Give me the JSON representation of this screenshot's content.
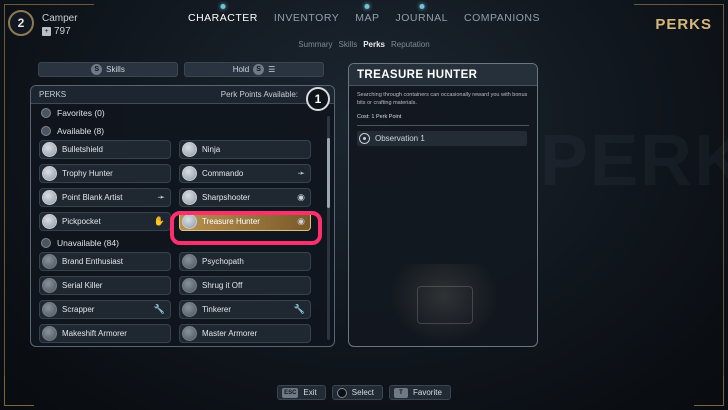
{
  "player": {
    "level": "2",
    "name": "Camper",
    "xp": "797"
  },
  "nav": {
    "tabs": [
      "CHARACTER",
      "INVENTORY",
      "MAP",
      "JOURNAL",
      "COMPANIONS"
    ],
    "active_tab": "CHARACTER",
    "subtabs": [
      "Summary",
      "Skills",
      "Perks",
      "Reputation"
    ],
    "active_subtab": "Perks"
  },
  "screen_title": "PERKS",
  "toolbar": {
    "skills_key": "S",
    "skills_label": "Skills",
    "hold_label": "Hold",
    "hold_key": "S"
  },
  "perks_panel": {
    "header": "PERKS",
    "points_label": "Perk Points Available:",
    "points": "1",
    "favorites": "Favorites (0)",
    "available": "Available (8)",
    "unavailable": "Unavailable (84)",
    "available_perks": [
      {
        "left": "Bulletshield",
        "right": "Ninja"
      },
      {
        "left": "Trophy Hunter",
        "right": "Commando"
      },
      {
        "left": "Point Blank Artist",
        "right": "Sharpshooter"
      },
      {
        "left": "Pickpocket",
        "right": "Treasure Hunter"
      }
    ],
    "unavailable_perks": [
      {
        "left": "Brand Enthusiast",
        "right": "Psychopath"
      },
      {
        "left": "Serial Killer",
        "right": "Shrug it Off"
      },
      {
        "left": "Scrapper",
        "right": "Tinkerer"
      },
      {
        "left": "Makeshift Armorer",
        "right": "Master Armorer"
      }
    ],
    "selected": "Treasure Hunter"
  },
  "detail": {
    "title": "TREASURE HUNTER",
    "description": "Searching through containers can occasionally reward you with bonus bits or crafting materials.",
    "cost": "Cost: 1 Perk Point",
    "requirement": "Observation 1",
    "background_word": "PERKS"
  },
  "footer": [
    {
      "key": "ESC",
      "label": "Exit"
    },
    {
      "key": "",
      "label": "Select"
    },
    {
      "key": "T",
      "label": "Favorite"
    }
  ]
}
